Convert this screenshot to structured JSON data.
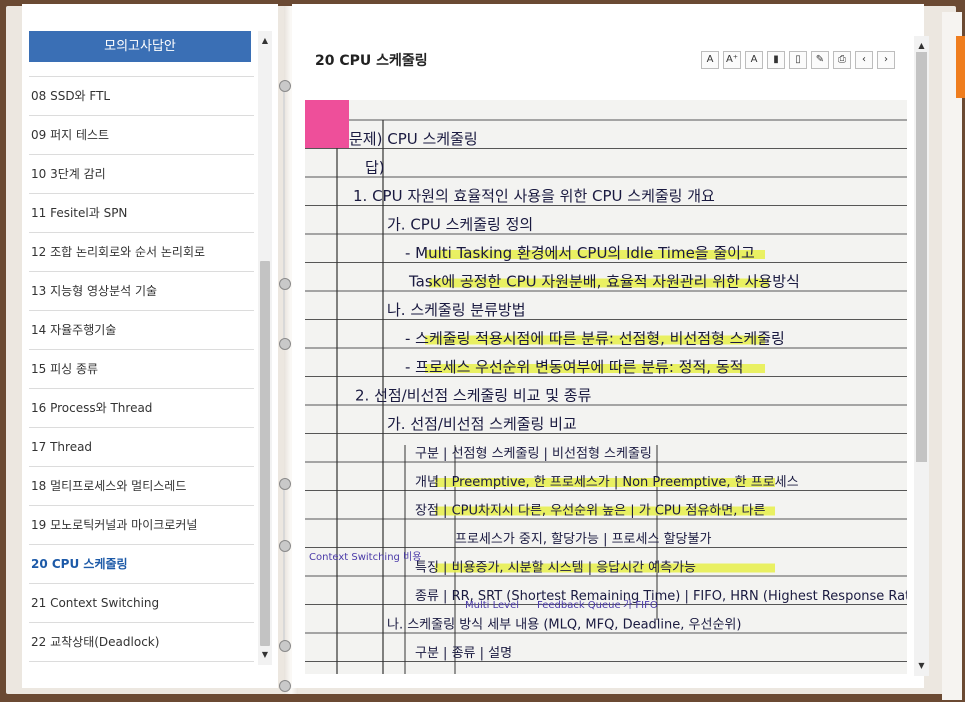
{
  "sidebar": {
    "header": "모의고사답안",
    "items": [
      {
        "label": "08 SSD와 FTL"
      },
      {
        "label": "09 퍼지 테스트"
      },
      {
        "label": "10 3단계 감리"
      },
      {
        "label": "11 Fesitel과 SPN"
      },
      {
        "label": "12 조합 논리회로와 순서 논리회로"
      },
      {
        "label": "13 지능형 영상분석 기술"
      },
      {
        "label": "14 자율주행기술"
      },
      {
        "label": "15 피싱 종류"
      },
      {
        "label": "16 Process와 Thread"
      },
      {
        "label": "17 Thread"
      },
      {
        "label": "18 멀티프로세스와 멀티스레드"
      },
      {
        "label": "19 모노로틱커널과 마이크로커널"
      },
      {
        "label": "20 CPU 스케줄링",
        "active": true
      },
      {
        "label": "21 Context Switching"
      },
      {
        "label": "22 교착상태(Deadlock)"
      }
    ]
  },
  "document": {
    "title": "20 CPU 스케줄링",
    "toolbar": [
      {
        "icon": "font-size-icon",
        "glyph": "A"
      },
      {
        "icon": "font-increase-icon",
        "glyph": "A⁺"
      },
      {
        "icon": "font-decrease-icon",
        "glyph": "A"
      },
      {
        "icon": "bookmark-icon",
        "glyph": "▮"
      },
      {
        "icon": "bookmark-remove-icon",
        "glyph": "▯"
      },
      {
        "icon": "edit-note-icon",
        "glyph": "✎"
      },
      {
        "icon": "print-icon",
        "glyph": "⎙"
      },
      {
        "icon": "prev-page-icon",
        "glyph": "‹"
      },
      {
        "icon": "next-page-icon",
        "glyph": "›"
      }
    ],
    "note_lines": [
      "문제) CPU 스케줄링",
      "답)",
      "1. CPU 자원의 효율적인 사용을 위한 CPU 스케줄링 개요",
      "가. CPU 스케줄링 정의",
      "- Multi Tasking 환경에서 CPU의 Idle Time을 줄이고",
      "Task에 공정한 CPU 자원분배, 효율적 자원관리 위한 사용방식",
      "나. 스케줄링 분류방법",
      "- 스케줄링 적용시점에 따른 분류: 선점형, 비선점형 스케줄링",
      "- 프로세스 우선순위 변동여부에 따른 분류: 정적, 동적",
      "2. 선점/비선점 스케줄링 비교 및 종류",
      "가. 선점/비선점 스케줄링 비교",
      "구분 | 선점형 스케줄링 | 비선점형 스케줄링",
      "개념 | Preemptive, 한 프로세스가 | Non Preemptive, 한 프로세스",
      "장점 | CPU차지시 다른, 우선순위 높은 | 가 CPU 점유하면, 다른",
      "프로세스가 중지, 할당가능 | 프로세스 할당불가",
      "특징 | 비용증가, 시분할 시스템 | 응답시간 예측가능",
      "종류 | RR, SRT (Shortest Remaining Time) | FIFO, HRN (Highest Response Ratio Next)",
      "나. 스케줄링 방식 세부 내용 (MLQ, MFQ, Deadline, 우선순위)",
      "구분 | 종류 | 설명"
    ],
    "annotations": [
      "Context Switching 비용",
      "Multi Level",
      "Feedback Queue",
      "가 FIFO"
    ]
  },
  "colors": {
    "header_blue": "#3a6fb5",
    "active_item": "#1d5aa8",
    "binder_wood": "#6b4a33",
    "highlight_yellow": "#e8f04a",
    "ink_red": "#d0262e",
    "ink_purple": "#4a3aa8",
    "sticky_pink": "#ee4f9a",
    "accent_orange": "#ef7d1e"
  }
}
